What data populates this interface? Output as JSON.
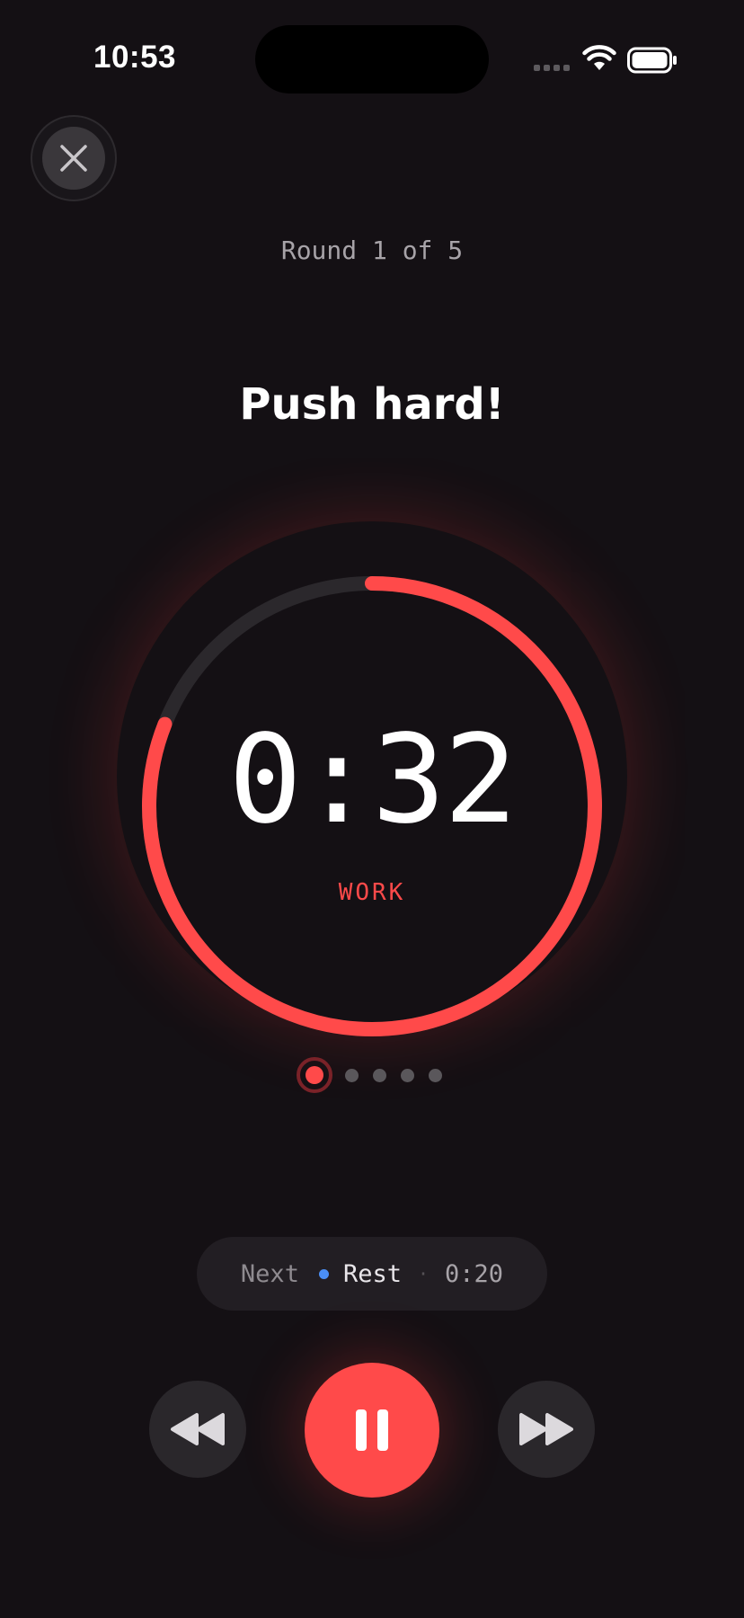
{
  "status_bar": {
    "time": "10:53",
    "icons": [
      "cellular-signal-icon",
      "wifi-icon",
      "battery-icon"
    ]
  },
  "session": {
    "round_label": "Round 1 of 5",
    "current_round": 1,
    "total_rounds": 5,
    "headline": "Push hard!"
  },
  "timer": {
    "display": "0:32",
    "phase": "WORK",
    "progress_fraction": 0.81,
    "accent_color": "#ff4a4a"
  },
  "up_next": {
    "label": "Next",
    "name": "Rest",
    "separator": "·",
    "duration": "0:20",
    "indicator_color": "#4b8ff5"
  },
  "controls": {
    "previous": "rewind-icon",
    "pause": "pause-icon",
    "next": "fast-forward-icon"
  }
}
